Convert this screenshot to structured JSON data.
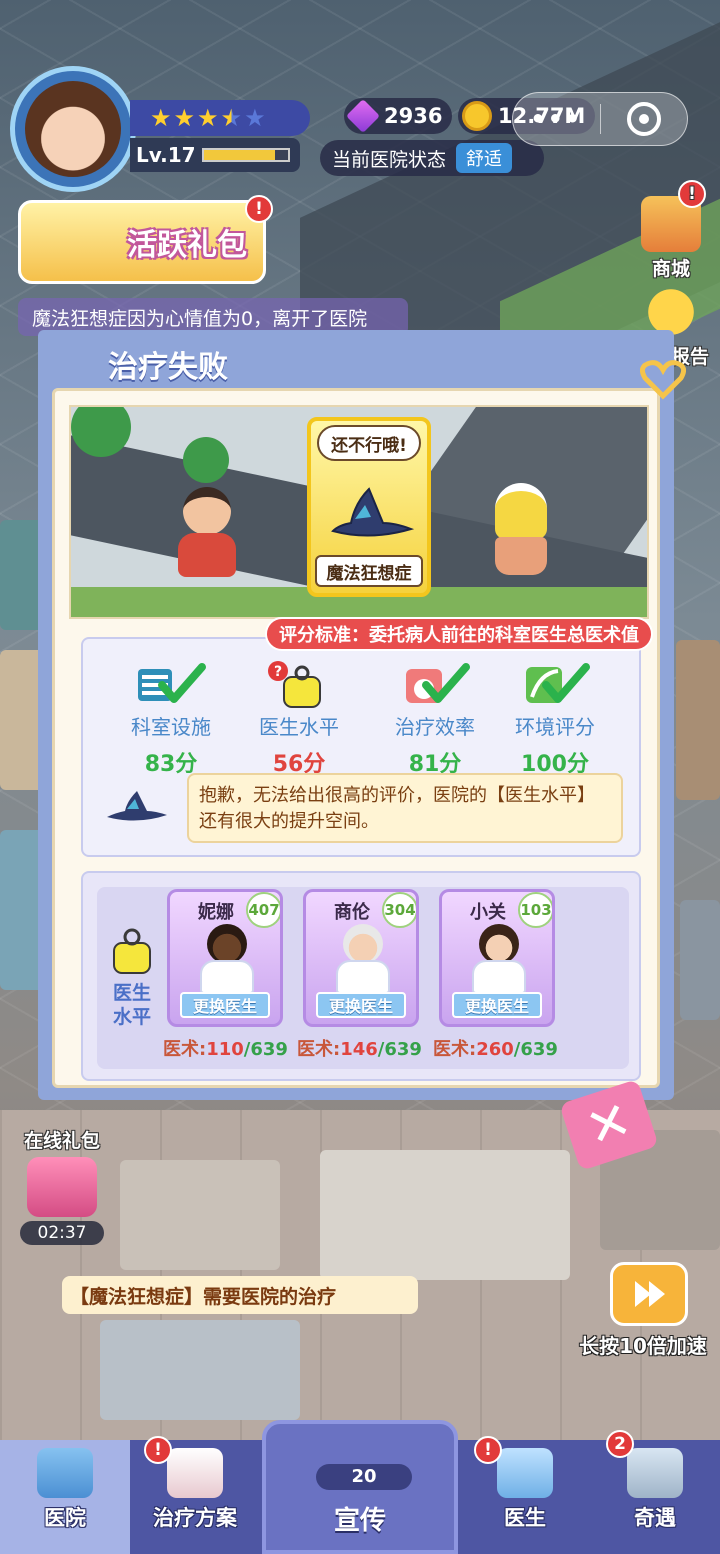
{
  "hud": {
    "level": "Lv.17",
    "level_progress": 0.85,
    "stars_filled": 3.5,
    "stars_total": 5,
    "gems": "2936",
    "coins": "12.77M",
    "status_label": "当前医院状态",
    "status_value": "舒适",
    "capsule_menu": "•••"
  },
  "left_panel": {
    "gift_title": "活跃礼包",
    "notice": "魔法狂想症因为心情值为0，离开了医院"
  },
  "side_buttons": [
    {
      "label": "商城"
    },
    {
      "label": "医院报告"
    }
  ],
  "modal": {
    "title": "治疗失败",
    "speech": "还不行哦!",
    "disease_name": "魔法狂想症",
    "criteria": "评分标准：委托病人前往的科室医生总医术值",
    "metrics": [
      {
        "label": "科室设施",
        "value": "83分",
        "status": "good"
      },
      {
        "label": "医生水平",
        "value": "56分",
        "status": "bad"
      },
      {
        "label": "治疗效率",
        "value": "81分",
        "status": "good"
      },
      {
        "label": "环境评分",
        "value": "100分",
        "status": "good"
      }
    ],
    "advice": "抱歉，无法给出很高的评价，医院的【医生水平】还有很大的提升空间。",
    "dept_label": "医生水平",
    "doctors": [
      {
        "name": "妮娜",
        "level": "407",
        "change": "更换医生",
        "skill_label": "医术:",
        "skill_current": "110",
        "skill_max": "/639"
      },
      {
        "name": "商伦",
        "level": "304",
        "change": "更换医生",
        "skill_label": "医术:",
        "skill_current": "146",
        "skill_max": "/639"
      },
      {
        "name": "小关",
        "level": "103",
        "change": "更换医生",
        "skill_label": "医术:",
        "skill_current": "260",
        "skill_max": "/639"
      }
    ],
    "close_symbol": "✕"
  },
  "world": {
    "online_gift_label": "在线礼包",
    "online_timer": "02:37",
    "treat_banner": "【魔法狂想症】需要医院的治疗",
    "speed_label": "长按10倍加速"
  },
  "nav": {
    "items": [
      {
        "label": "医院",
        "active": true
      },
      {
        "label": "治疗方案"
      },
      {
        "label": "宣传",
        "count": "20"
      },
      {
        "label": "医生"
      },
      {
        "label": "奇遇",
        "badge": "2"
      }
    ]
  },
  "colors": {
    "accent": "#4e56a3",
    "good": "#35b34a",
    "bad": "#e0443e",
    "criteria_bg": "#e84d4d"
  }
}
